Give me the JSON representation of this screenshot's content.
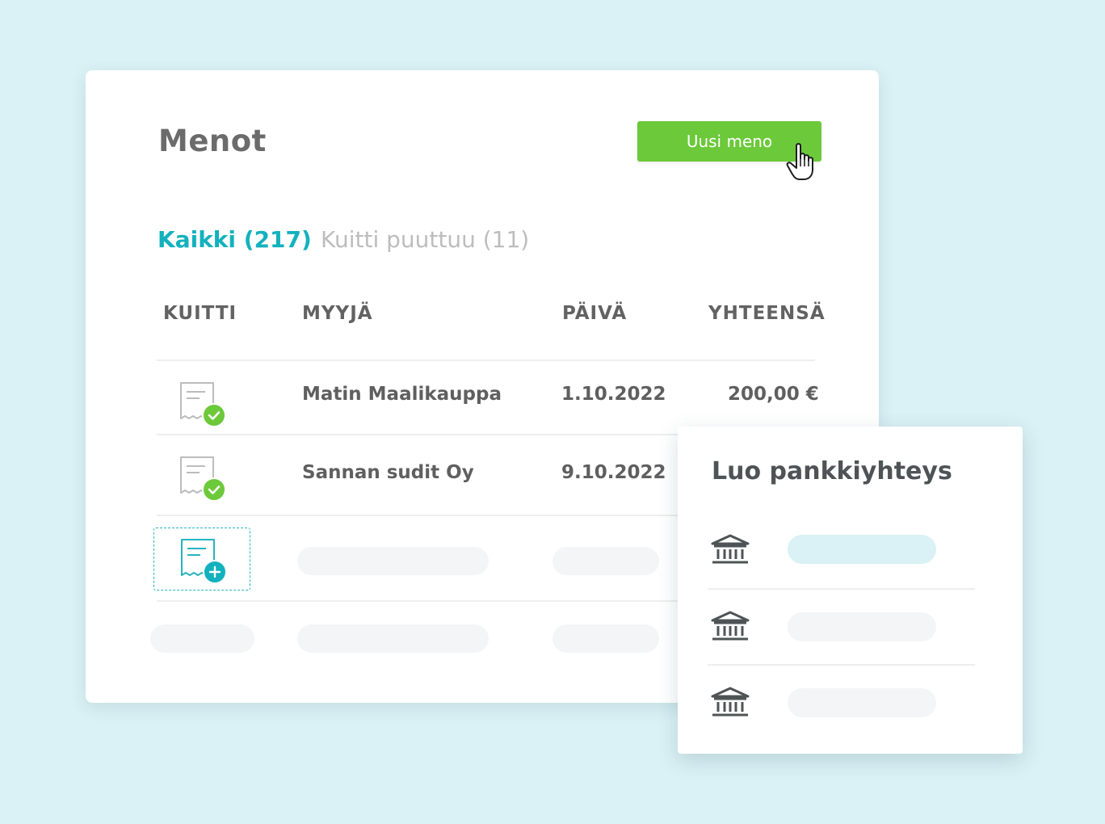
{
  "expenses": {
    "title": "Menot",
    "new_button_label": "Uusi meno",
    "tabs": [
      {
        "label": "Kaikki (217)",
        "active": true
      },
      {
        "label": "Kuitti puuttuu (11)",
        "active": false
      }
    ],
    "columns": [
      "KUITTI",
      "MYYJÄ",
      "PÄIVÄ",
      "YHTEENSÄ"
    ],
    "rows": [
      {
        "vendor": "Matin Maalikauppa",
        "date": "1.10.2022",
        "total": "200,00 €",
        "receipt": "receipt-check-icon"
      },
      {
        "vendor": "Sannan sudit Oy",
        "date": "9.10.2022",
        "total": "",
        "receipt": "receipt-check-icon"
      }
    ]
  },
  "bank_panel": {
    "title": "Luo pankkiyhteys",
    "banks": [
      {
        "icon": "bank-icon",
        "active": true
      },
      {
        "icon": "bank-icon",
        "active": false
      },
      {
        "icon": "bank-icon",
        "active": false
      }
    ]
  },
  "colors": {
    "background": "#daf1f5",
    "accent_teal": "#13b1be",
    "button_green": "#6cc93a",
    "check_green": "#6cc93a",
    "muted_text": "#bdbdbd"
  }
}
